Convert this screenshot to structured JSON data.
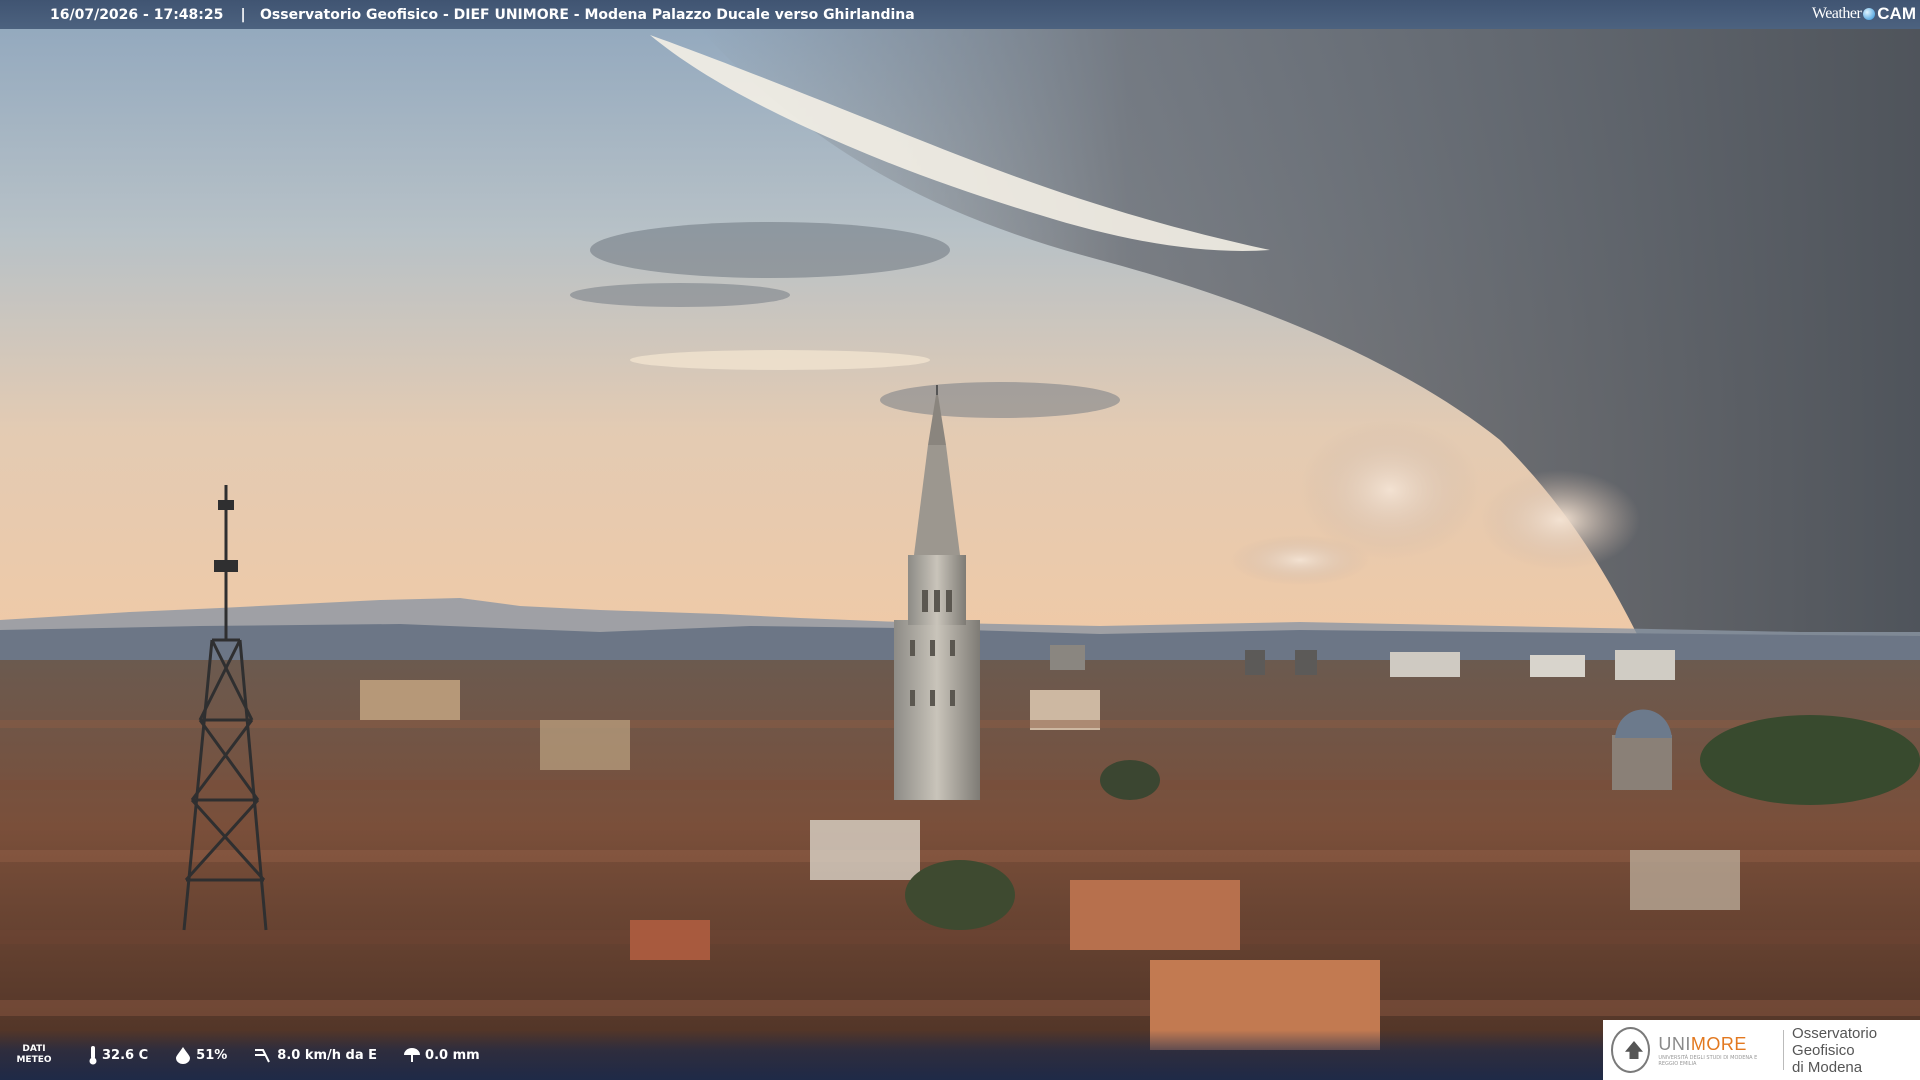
{
  "header": {
    "timestamp": "16/07/2026 - 17:48:25",
    "separator": "|",
    "title": "Osservatorio Geofisico - DIEF UNIMORE - Modena Palazzo Ducale verso Ghirlandina"
  },
  "brand": {
    "part1": "Weather",
    "part2": "CAM"
  },
  "weather": {
    "label_line1": "DATI",
    "label_line2": "METEO",
    "temperature": "32.6 C",
    "humidity": "51%",
    "wind": "8.0 km/h da E",
    "rain": "0.0 mm"
  },
  "logo": {
    "uni_part1": "UNI",
    "uni_part2": "MORE",
    "uni_sub": "UNIVERSITÀ DEGLI STUDI DI MODENA E REGGIO EMILIA",
    "obs_line1": "Osservatorio Geofisico",
    "obs_line2": "di Modena"
  },
  "colors": {
    "sky_top": "#8ba3bb",
    "sky_glow": "#e8c7a8",
    "storm": "#5a5f66",
    "roofs": "#6b4a3a",
    "accent_orange": "#e2781f"
  }
}
